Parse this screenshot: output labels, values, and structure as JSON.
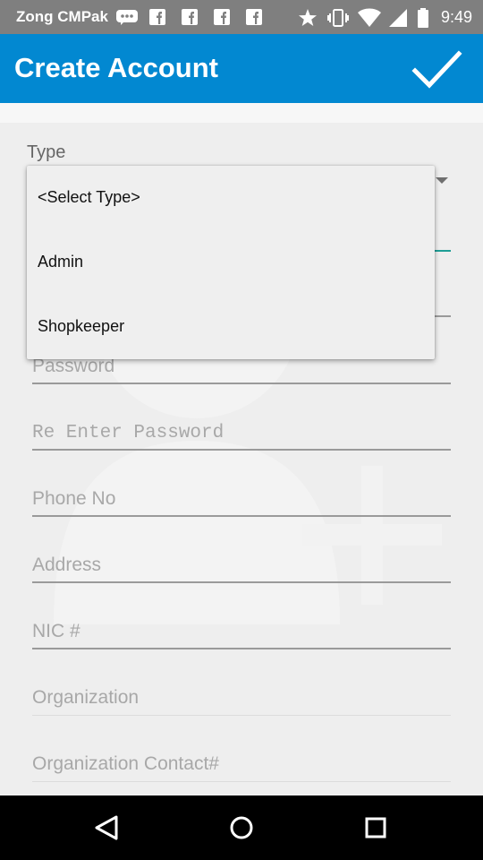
{
  "status_bar": {
    "carrier": "Zong CMPak",
    "time": "9:49",
    "icons": [
      "messenger-icon",
      "facebook-icon",
      "facebook-icon",
      "facebook-icon",
      "facebook-icon",
      "star-icon",
      "vibrate-icon",
      "wifi-icon",
      "signal-icon",
      "battery-icon"
    ]
  },
  "app_bar": {
    "title": "Create Account",
    "action_icon": "check-icon"
  },
  "form": {
    "type_label": "Type",
    "fields": [
      {
        "placeholder": "Password"
      },
      {
        "placeholder": "Re Enter Password"
      },
      {
        "placeholder": "Phone No"
      },
      {
        "placeholder": "Address"
      },
      {
        "placeholder": "NIC #"
      },
      {
        "placeholder": "Organization"
      },
      {
        "placeholder": "Organization Contact#"
      }
    ]
  },
  "type_dropdown": {
    "options": [
      "<Select Type>",
      "Admin",
      "Shopkeeper"
    ]
  },
  "nav_bar": {
    "icons": [
      "back-icon",
      "home-icon",
      "recents-icon"
    ]
  },
  "colors": {
    "app_bar": "#0288d1",
    "status_bar": "#7f7f7f",
    "accent_underline": "#1e9e96",
    "background": "#eeeeee"
  }
}
